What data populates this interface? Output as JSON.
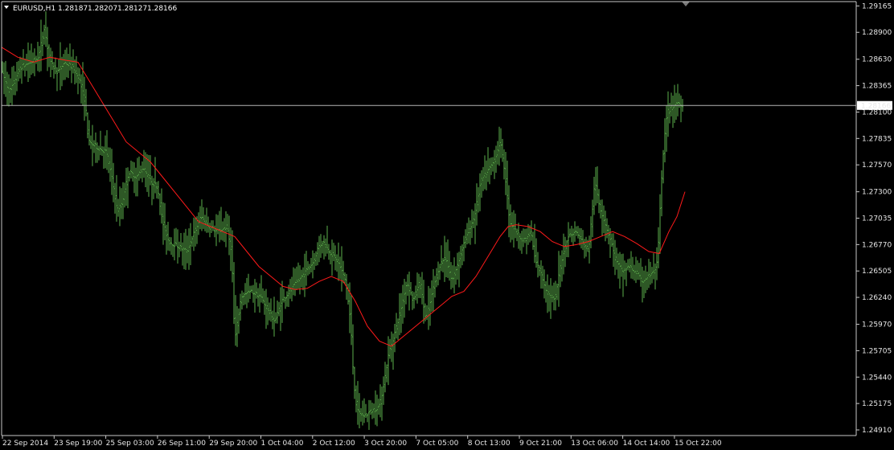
{
  "header": {
    "symbol_timeframe": "EURUSD,H1",
    "open": "1.28187",
    "high": "1.28207",
    "low": "1.28127",
    "close": "1.28166"
  },
  "colors": {
    "background": "#000000",
    "axis": "#c8c8c8",
    "bars": "#5daf4c",
    "moving_average": "#ff1a1a",
    "price_line": "#b4b4b4",
    "price_label_bg": "#ffffff",
    "price_label_text": "#000000"
  },
  "current_price_label": "1.28166",
  "chart_data": {
    "type": "ohlc",
    "symbol": "EURUSD",
    "timeframe": "H1",
    "ylim": [
      1.2491,
      1.2916
    ],
    "y_ticks": [
      "1.29165",
      "1.28900",
      "1.28630",
      "1.28365",
      "1.28100",
      "1.27835",
      "1.27570",
      "1.27300",
      "1.27035",
      "1.26770",
      "1.26505",
      "1.26240",
      "1.25970",
      "1.25705",
      "1.25440",
      "1.25175",
      "1.24910"
    ],
    "x_ticks": [
      "22 Sep 2014",
      "23 Sep 19:00",
      "25 Sep 03:00",
      "26 Sep 11:00",
      "29 Sep 20:00",
      "1 Oct 04:00",
      "2 Oct 12:00",
      "3 Oct 20:00",
      "7 Oct 05:00",
      "8 Oct 13:00",
      "9 Oct 21:00",
      "13 Oct 06:00",
      "14 Oct 14:00",
      "15 Oct 22:00"
    ],
    "grid": false,
    "price_path": [
      [
        0,
        1.2855
      ],
      [
        12,
        1.283
      ],
      [
        25,
        1.2855
      ],
      [
        38,
        1.286
      ],
      [
        48,
        1.2865
      ],
      [
        55,
        1.2895
      ],
      [
        62,
        1.286
      ],
      [
        72,
        1.285
      ],
      [
        80,
        1.286
      ],
      [
        90,
        1.2855
      ],
      [
        98,
        1.2845
      ],
      [
        106,
        1.282
      ],
      [
        110,
        1.278
      ],
      [
        120,
        1.2775
      ],
      [
        132,
        1.277
      ],
      [
        140,
        1.274
      ],
      [
        146,
        1.271
      ],
      [
        152,
        1.272
      ],
      [
        160,
        1.275
      ],
      [
        170,
        1.2745
      ],
      [
        178,
        1.2755
      ],
      [
        188,
        1.274
      ],
      [
        196,
        1.2735
      ],
      [
        202,
        1.27
      ],
      [
        210,
        1.268
      ],
      [
        222,
        1.2675
      ],
      [
        232,
        1.267
      ],
      [
        242,
        1.269
      ],
      [
        250,
        1.2705
      ],
      [
        260,
        1.2695
      ],
      [
        270,
        1.269
      ],
      [
        282,
        1.2695
      ],
      [
        288,
        1.267
      ],
      [
        292,
        1.258
      ],
      [
        300,
        1.2625
      ],
      [
        312,
        1.263
      ],
      [
        324,
        1.2625
      ],
      [
        334,
        1.261
      ],
      [
        342,
        1.26
      ],
      [
        350,
        1.262
      ],
      [
        360,
        1.263
      ],
      [
        370,
        1.264
      ],
      [
        380,
        1.265
      ],
      [
        390,
        1.266
      ],
      [
        396,
        1.2675
      ],
      [
        402,
        1.268
      ],
      [
        410,
        1.267
      ],
      [
        420,
        1.266
      ],
      [
        430,
        1.264
      ],
      [
        436,
        1.26
      ],
      [
        440,
        1.254
      ],
      [
        444,
        1.251
      ],
      [
        452,
        1.2505
      ],
      [
        462,
        1.251
      ],
      [
        472,
        1.2515
      ],
      [
        478,
        1.254
      ],
      [
        484,
        1.257
      ],
      [
        490,
        1.2585
      ],
      [
        498,
        1.261
      ],
      [
        506,
        1.264
      ],
      [
        514,
        1.262
      ],
      [
        522,
        1.264
      ],
      [
        530,
        1.26
      ],
      [
        538,
        1.263
      ],
      [
        546,
        1.2655
      ],
      [
        554,
        1.2665
      ],
      [
        562,
        1.264
      ],
      [
        570,
        1.266
      ],
      [
        580,
        1.2685
      ],
      [
        590,
        1.2705
      ],
      [
        598,
        1.274
      ],
      [
        606,
        1.275
      ],
      [
        614,
        1.276
      ],
      [
        622,
        1.278
      ],
      [
        628,
        1.275
      ],
      [
        634,
        1.27
      ],
      [
        642,
        1.269
      ],
      [
        652,
        1.268
      ],
      [
        660,
        1.269
      ],
      [
        666,
        1.266
      ],
      [
        672,
        1.265
      ],
      [
        680,
        1.263
      ],
      [
        690,
        1.262
      ],
      [
        698,
        1.266
      ],
      [
        706,
        1.2685
      ],
      [
        716,
        1.269
      ],
      [
        724,
        1.268
      ],
      [
        732,
        1.267
      ],
      [
        740,
        1.274
      ],
      [
        746,
        1.2715
      ],
      [
        752,
        1.27
      ],
      [
        760,
        1.268
      ],
      [
        766,
        1.266
      ],
      [
        774,
        1.265
      ],
      [
        782,
        1.2655
      ],
      [
        790,
        1.265
      ],
      [
        798,
        1.264
      ],
      [
        806,
        1.2645
      ],
      [
        814,
        1.265
      ],
      [
        818,
        1.266
      ],
      [
        822,
        1.273
      ],
      [
        826,
        1.278
      ],
      [
        830,
        1.281
      ],
      [
        836,
        1.2815
      ],
      [
        842,
        1.282
      ],
      [
        850,
        1.2817
      ]
    ],
    "moving_average": [
      [
        0,
        1.2875
      ],
      [
        20,
        1.2865
      ],
      [
        40,
        1.286
      ],
      [
        60,
        1.2865
      ],
      [
        80,
        1.2862
      ],
      [
        95,
        1.286
      ],
      [
        110,
        1.284
      ],
      [
        125,
        1.282
      ],
      [
        140,
        1.28
      ],
      [
        155,
        1.278
      ],
      [
        170,
        1.277
      ],
      [
        185,
        1.276
      ],
      [
        200,
        1.2745
      ],
      [
        215,
        1.273
      ],
      [
        230,
        1.2715
      ],
      [
        245,
        1.27
      ],
      [
        260,
        1.2695
      ],
      [
        275,
        1.269
      ],
      [
        290,
        1.2685
      ],
      [
        305,
        1.267
      ],
      [
        320,
        1.2655
      ],
      [
        335,
        1.2645
      ],
      [
        350,
        1.2635
      ],
      [
        365,
        1.2632
      ],
      [
        380,
        1.2633
      ],
      [
        395,
        1.264
      ],
      [
        410,
        1.2645
      ],
      [
        425,
        1.264
      ],
      [
        440,
        1.262
      ],
      [
        455,
        1.2595
      ],
      [
        470,
        1.258
      ],
      [
        485,
        1.2575
      ],
      [
        500,
        1.2585
      ],
      [
        515,
        1.2595
      ],
      [
        530,
        1.2605
      ],
      [
        545,
        1.2615
      ],
      [
        560,
        1.2625
      ],
      [
        575,
        1.263
      ],
      [
        590,
        1.2645
      ],
      [
        605,
        1.2665
      ],
      [
        620,
        1.2685
      ],
      [
        630,
        1.2695
      ],
      [
        640,
        1.2697
      ],
      [
        655,
        1.2695
      ],
      [
        670,
        1.269
      ],
      [
        685,
        1.268
      ],
      [
        700,
        1.2675
      ],
      [
        715,
        1.2677
      ],
      [
        730,
        1.268
      ],
      [
        745,
        1.2685
      ],
      [
        760,
        1.269
      ],
      [
        775,
        1.2685
      ],
      [
        790,
        1.2678
      ],
      [
        805,
        1.267
      ],
      [
        818,
        1.2668
      ],
      [
        830,
        1.269
      ],
      [
        840,
        1.2705
      ],
      [
        850,
        1.273
      ]
    ]
  }
}
